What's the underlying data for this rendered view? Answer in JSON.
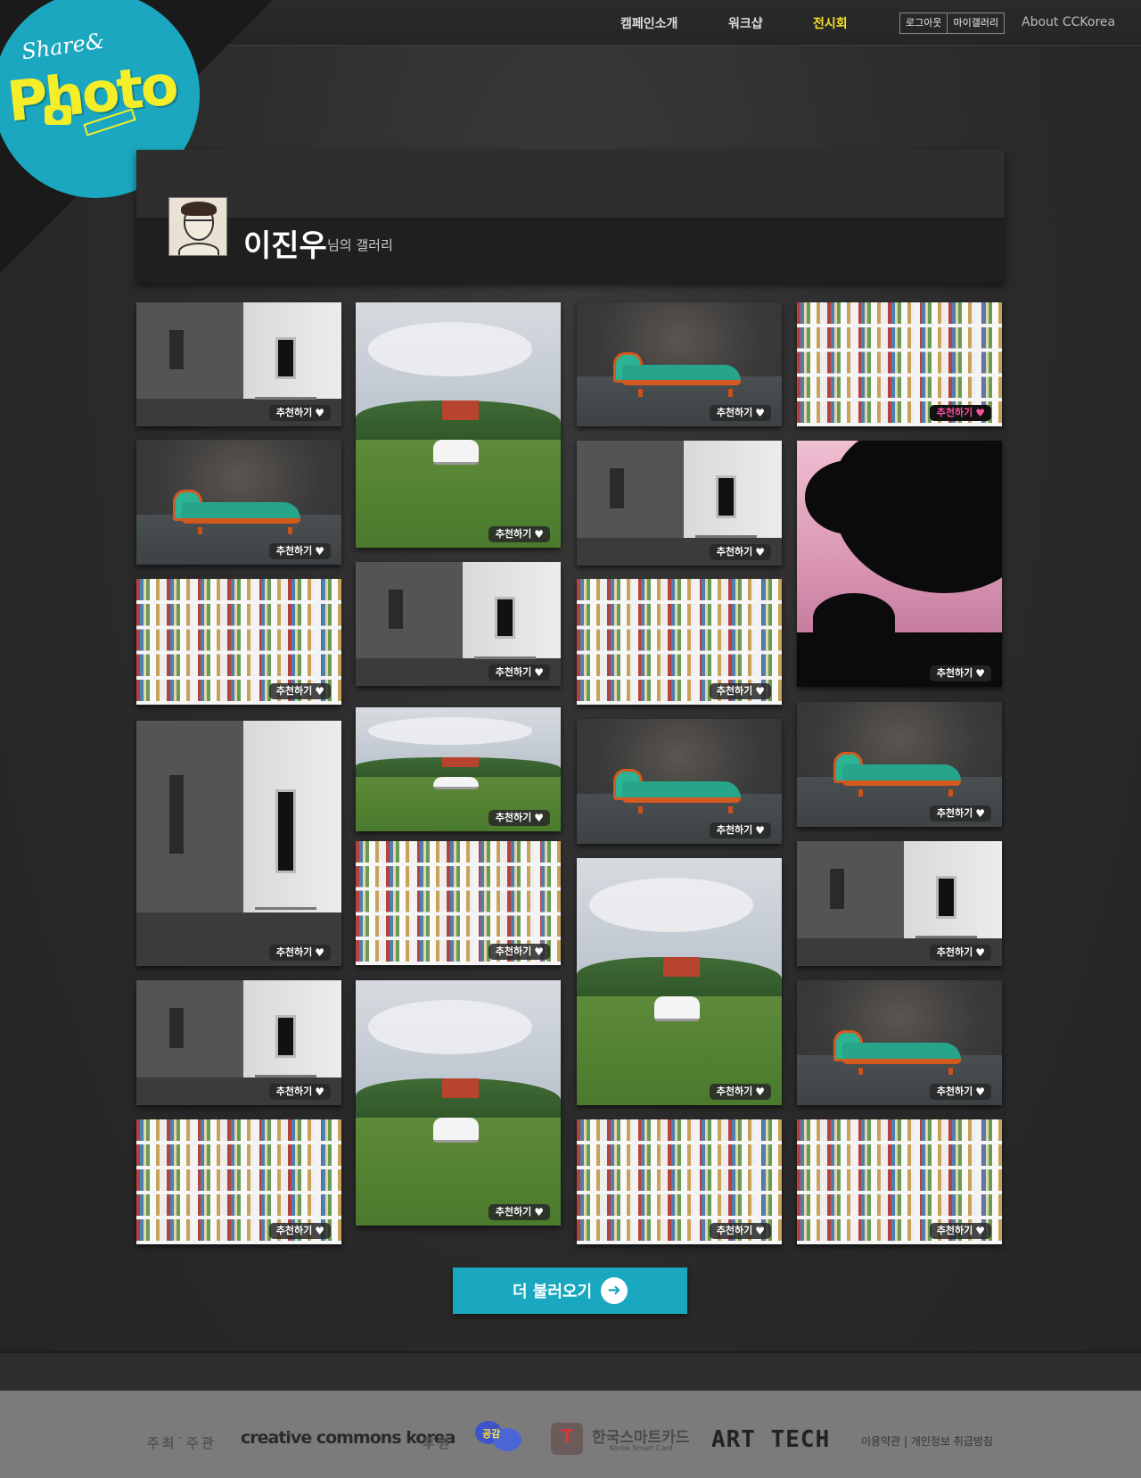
{
  "nav": {
    "campaign": "캠페인소개",
    "workshop": "워크샵",
    "exhibition": "전시회",
    "logout": "로그아웃",
    "my_gallery": "마이갤러리",
    "about": "About CCKorea"
  },
  "logo": {
    "line1": "Share&",
    "line2": "Photo"
  },
  "gallery": {
    "user_name": "이진우",
    "suffix": "님의 갤러리"
  },
  "recommend_label": "추천하기",
  "load_more": "더 불러오기",
  "footer": {
    "host_label": "주최˙주관",
    "cc": "creative commons korea",
    "sponsor_label": "후원",
    "seoul": "공감",
    "ksc": "한국스마트카드",
    "ksc_sub": "Korea Smart Card",
    "tmoney": "T",
    "art": "ART TECH",
    "links": "이용약관 | 개인정보 취급방침"
  },
  "colors": {
    "accent": "#1aa7c0",
    "active_nav": "#f6e22a",
    "recommend_active": "#ff4fa3"
  },
  "photos": [
    {
      "scene": "house",
      "recommended": false
    },
    {
      "scene": "field",
      "recommended": false
    },
    {
      "scene": "sofa",
      "recommended": false
    },
    {
      "scene": "books",
      "recommended": true
    },
    {
      "scene": "sofa",
      "recommended": false
    },
    {
      "scene": "house",
      "recommended": false
    },
    {
      "scene": "tree",
      "recommended": false
    },
    {
      "scene": "books",
      "recommended": false
    },
    {
      "scene": "house",
      "recommended": false
    },
    {
      "scene": "books",
      "recommended": false
    },
    {
      "scene": "field",
      "recommended": false
    },
    {
      "scene": "sofa",
      "recommended": false
    },
    {
      "scene": "sofa",
      "recommended": false
    },
    {
      "scene": "house",
      "recommended": false
    },
    {
      "scene": "books",
      "recommended": false
    },
    {
      "scene": "field",
      "recommended": false
    },
    {
      "scene": "house",
      "recommended": false
    },
    {
      "scene": "house",
      "recommended": false
    },
    {
      "scene": "field",
      "recommended": false
    },
    {
      "scene": "sofa",
      "recommended": false
    },
    {
      "scene": "books",
      "recommended": false
    },
    {
      "scene": "books",
      "recommended": false
    },
    {
      "scene": "books",
      "recommended": false
    }
  ]
}
